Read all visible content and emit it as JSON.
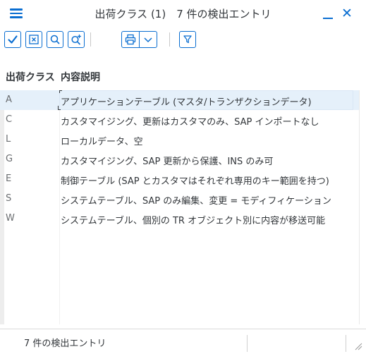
{
  "window": {
    "title": "出荷クラス (1)　7 件の検出エントリ",
    "menu_icon": "hamburger-icon",
    "minimize_icon": "minimize-icon",
    "close_label": "✕"
  },
  "toolbar": {
    "buttons": [
      {
        "name": "confirm-button",
        "icon": "checkmark-icon"
      },
      {
        "name": "cancel-button",
        "icon": "close-box-icon"
      },
      {
        "name": "search-button",
        "icon": "search-icon"
      },
      {
        "name": "search-more-button",
        "icon": "search-plus-icon"
      },
      {
        "name": "print-button",
        "icon": "print-icon"
      },
      {
        "name": "print-dropdown-button",
        "icon": "chevron-down-icon"
      },
      {
        "name": "filter-button",
        "icon": "filter-icon"
      }
    ]
  },
  "table": {
    "columns": [
      "出荷クラス",
      "内容説明"
    ],
    "rows": [
      {
        "code": "A",
        "desc": "アプリケーションテーブル (マスタ/トランザクションデータ)"
      },
      {
        "code": "C",
        "desc": "カスタマイジング、更新はカスタマのみ、SAP インポートなし"
      },
      {
        "code": "L",
        "desc": "ローカルデータ、空"
      },
      {
        "code": "G",
        "desc": "カスタマイジング、SAP 更新から保護、INS のみ可"
      },
      {
        "code": "E",
        "desc": "制御テーブル (SAP とカスタマはそれぞれ専用のキー範囲を持つ)"
      },
      {
        "code": "S",
        "desc": "システムテーブル、SAP のみ編集、変更 = モディフィケーション"
      },
      {
        "code": "W",
        "desc": "システムテーブル、個別の TR オブジェクト別に内容が移送可能"
      }
    ],
    "selected_index": 0
  },
  "status": {
    "text": "7 件の検出エントリ"
  },
  "colors": {
    "accent": "#0a6ed1",
    "selected_row": "#e5f0fa"
  }
}
